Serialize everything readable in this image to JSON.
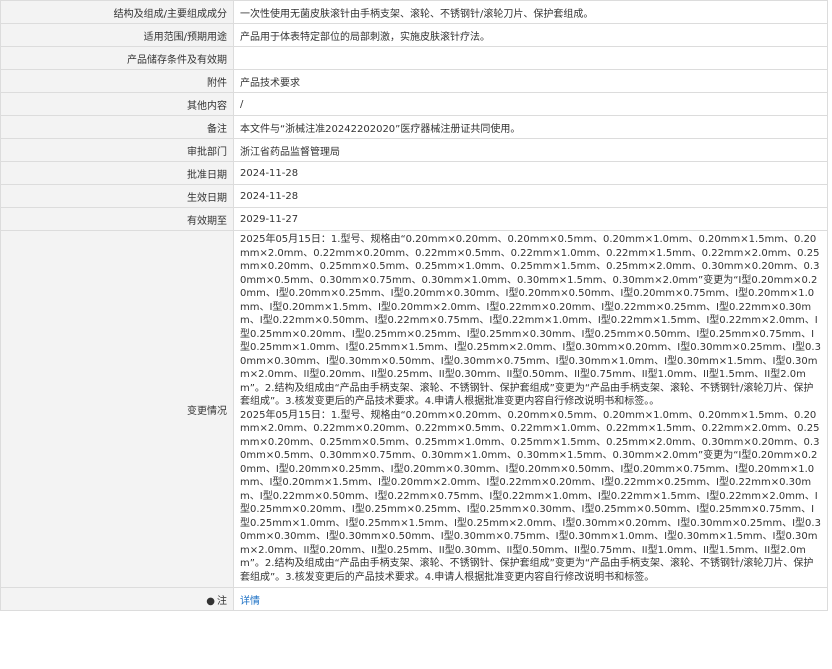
{
  "rows": [
    {
      "label": "结构及组成/主要组成成分",
      "value": "一次性使用无菌皮肤滚针由手柄支架、滚轮、不锈钢针/滚轮刀片、保护套组成。"
    },
    {
      "label": "适用范围/预期用途",
      "value": "产品用于体表特定部位的局部刺激，实施皮肤滚针疗法。"
    },
    {
      "label": "产品储存条件及有效期",
      "value": ""
    },
    {
      "label": "附件",
      "value": "产品技术要求"
    },
    {
      "label": "其他内容",
      "value": "/"
    },
    {
      "label": "备注",
      "value": "本文件与“浙械注准20242202020”医疗器械注册证共同使用。"
    },
    {
      "label": "审批部门",
      "value": "浙江省药品监督管理局"
    },
    {
      "label": "批准日期",
      "value": "2024-11-28"
    },
    {
      "label": "生效日期",
      "value": "2024-11-28"
    },
    {
      "label": "有效期至",
      "value": "2029-11-27"
    }
  ],
  "change": {
    "label": "变更情况",
    "text": "2025年05月15日：1.型号、规格由“0.20mm×0.20mm、0.20mm×0.5mm、0.20mm×1.0mm、0.20mm×1.5mm、0.20mm×2.0mm、0.22mm×0.20mm、0.22mm×0.5mm、0.22mm×1.0mm、0.22mm×1.5mm、0.22mm×2.0mm、0.25mm×0.20mm、0.25mm×0.5mm、0.25mm×1.0mm、0.25mm×1.5mm、0.25mm×2.0mm、0.30mm×0.20mm、0.30mm×0.5mm、0.30mm×0.75mm、0.30mm×1.0mm、0.30mm×1.5mm、0.30mm×2.0mm”变更为“I型0.20mm×0.20mm、I型0.20mm×0.25mm、I型0.20mm×0.30mm、I型0.20mm×0.50mm、I型0.20mm×0.75mm、I型0.20mm×1.0mm、I型0.20mm×1.5mm、I型0.20mm×2.0mm、I型0.22mm×0.20mm、I型0.22mm×0.25mm、I型0.22mm×0.30mm、I型0.22mm×0.50mm、I型0.22mm×0.75mm、I型0.22mm×1.0mm、I型0.22mm×1.5mm、I型0.22mm×2.0mm、I型0.25mm×0.20mm、I型0.25mm×0.25mm、I型0.25mm×0.30mm、I型0.25mm×0.50mm、I型0.25mm×0.75mm、I型0.25mm×1.0mm、I型0.25mm×1.5mm、I型0.25mm×2.0mm、I型0.30mm×0.20mm、I型0.30mm×0.25mm、I型0.30mm×0.30mm、I型0.30mm×0.50mm、I型0.30mm×0.75mm、I型0.30mm×1.0mm、I型0.30mm×1.5mm、I型0.30mm×2.0mm、II型0.20mm、II型0.25mm、II型0.30mm、II型0.50mm、II型0.75mm、II型1.0mm、II型1.5mm、II型2.0mm”。2.结构及组成由“产品由手柄支架、滚轮、不锈钢针、保护套组成”变更为“产品由手柄支架、滚轮、不锈钢针/滚轮刀片、保护套组成”。3.核发变更后的产品技术要求。4.申请人根据批准变更内容自行修改说明书和标签。。\n2025年05月15日：1.型号、规格由“0.20mm×0.20mm、0.20mm×0.5mm、0.20mm×1.0mm、0.20mm×1.5mm、0.20mm×2.0mm、0.22mm×0.20mm、0.22mm×0.5mm、0.22mm×1.0mm、0.22mm×1.5mm、0.22mm×2.0mm、0.25mm×0.20mm、0.25mm×0.5mm、0.25mm×1.0mm、0.25mm×1.5mm、0.25mm×2.0mm、0.30mm×0.20mm、0.30mm×0.5mm、0.30mm×0.75mm、0.30mm×1.0mm、0.30mm×1.5mm、0.30mm×2.0mm”变更为“I型0.20mm×0.20mm、I型0.20mm×0.25mm、I型0.20mm×0.30mm、I型0.20mm×0.50mm、I型0.20mm×0.75mm、I型0.20mm×1.0mm、I型0.20mm×1.5mm、I型0.20mm×2.0mm、I型0.22mm×0.20mm、I型0.22mm×0.25mm、I型0.22mm×0.30mm、I型0.22mm×0.50mm、I型0.22mm×0.75mm、I型0.22mm×1.0mm、I型0.22mm×1.5mm、I型0.22mm×2.0mm、I型0.25mm×0.20mm、I型0.25mm×0.25mm、I型0.25mm×0.30mm、I型0.25mm×0.50mm、I型0.25mm×0.75mm、I型0.25mm×1.0mm、I型0.25mm×1.5mm、I型0.25mm×2.0mm、I型0.30mm×0.20mm、I型0.30mm×0.25mm、I型0.30mm×0.30mm、I型0.30mm×0.50mm、I型0.30mm×0.75mm、I型0.30mm×1.0mm、I型0.30mm×1.5mm、I型0.30mm×2.0mm、II型0.20mm、II型0.25mm、II型0.30mm、II型0.50mm、II型0.75mm、II型1.0mm、II型1.5mm、II型2.0mm”。2.结构及组成由“产品由手柄支架、滚轮、不锈钢针、保护套组成”变更为“产品由手柄支架、滚轮、不锈钢针/滚轮刀片、保护套组成”。3.核发变更后的产品技术要求。4.申请人根据批准变更内容自行修改说明书和标签。"
  },
  "note": {
    "label": "注",
    "link_text": "详情",
    "icon": "pin-icon"
  }
}
